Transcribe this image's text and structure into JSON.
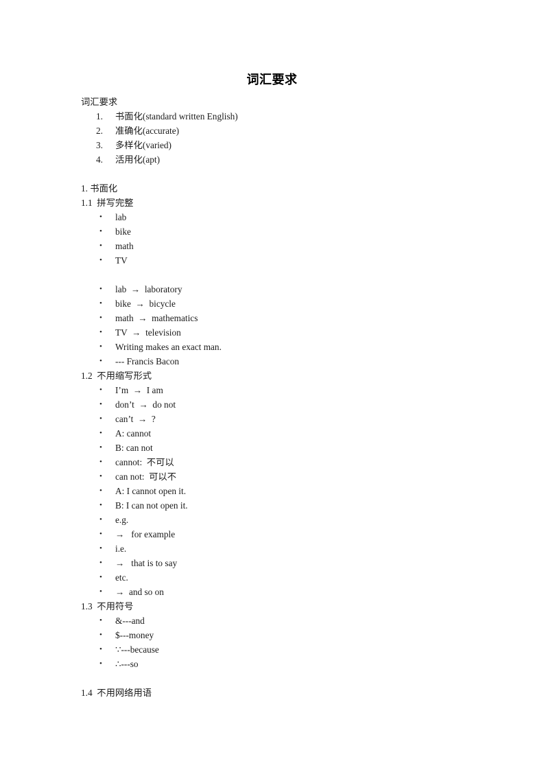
{
  "document": {
    "title": "词汇要求",
    "bullet_glyph": "•",
    "blocks": [
      {
        "kind": "paragraph",
        "name": "intro-paragraph",
        "text": "词汇要求"
      },
      {
        "kind": "numbered-list",
        "name": "requirements-list",
        "items": [
          {
            "marker": "1.",
            "text": "书面化(standard written English)"
          },
          {
            "marker": "2.",
            "text": "准确化(accurate)"
          },
          {
            "marker": "3.",
            "text": "多样化(varied)"
          },
          {
            "marker": "4.",
            "text": "活用化(apt)"
          }
        ]
      },
      {
        "kind": "spacer",
        "name": "spacer-after-requirements"
      },
      {
        "kind": "paragraph",
        "name": "heading-1",
        "text": "1. 书面化"
      },
      {
        "kind": "paragraph",
        "name": "heading-1-1",
        "text": "1.1  拼写完整"
      },
      {
        "kind": "bullet-list",
        "name": "abbreviation-examples-list",
        "items": [
          {
            "text": "lab"
          },
          {
            "text": "bike"
          },
          {
            "text": "math"
          },
          {
            "text": "TV"
          }
        ]
      },
      {
        "kind": "spacer",
        "name": "spacer-between-bullet-groups"
      },
      {
        "kind": "bullet-list",
        "name": "expanded-forms-list",
        "items": [
          {
            "text": "lab  →  laboratory"
          },
          {
            "text": "bike  →  bicycle"
          },
          {
            "text": "math  →  mathematics"
          },
          {
            "text": "TV  →  television"
          },
          {
            "text": "Writing makes an exact man."
          },
          {
            "text": "--- Francis Bacon"
          }
        ]
      },
      {
        "kind": "paragraph",
        "name": "heading-1-2",
        "text": "1.2  不用缩写形式"
      },
      {
        "kind": "bullet-list",
        "name": "contractions-list",
        "items": [
          {
            "text": "I’m  →  I am"
          },
          {
            "text": "don’t  →  do not"
          },
          {
            "text": "can’t  →  ?"
          },
          {
            "text": "A: cannot"
          },
          {
            "text": "B: can not"
          },
          {
            "text": "cannot:  不可以"
          },
          {
            "text": "can not:  可以不"
          },
          {
            "text": "A: I cannot open it."
          },
          {
            "text": "B: I can not open it."
          },
          {
            "text": "e.g."
          },
          {
            "text": "→   for example"
          },
          {
            "text": "i.e."
          },
          {
            "text": "→   that is to say"
          },
          {
            "text": "etc."
          },
          {
            "text": "→  and so on"
          }
        ]
      },
      {
        "kind": "paragraph",
        "name": "heading-1-3",
        "text": "1.3  不用符号"
      },
      {
        "kind": "bullet-list",
        "name": "symbols-list",
        "items": [
          {
            "text": "&---and"
          },
          {
            "text": "$---money"
          },
          {
            "text": "∵---because"
          },
          {
            "text": "∴---so"
          }
        ]
      },
      {
        "kind": "spacer",
        "name": "spacer-before-heading-1-4"
      },
      {
        "kind": "paragraph",
        "name": "heading-1-4",
        "text": "1.4  不用网络用语"
      }
    ]
  }
}
